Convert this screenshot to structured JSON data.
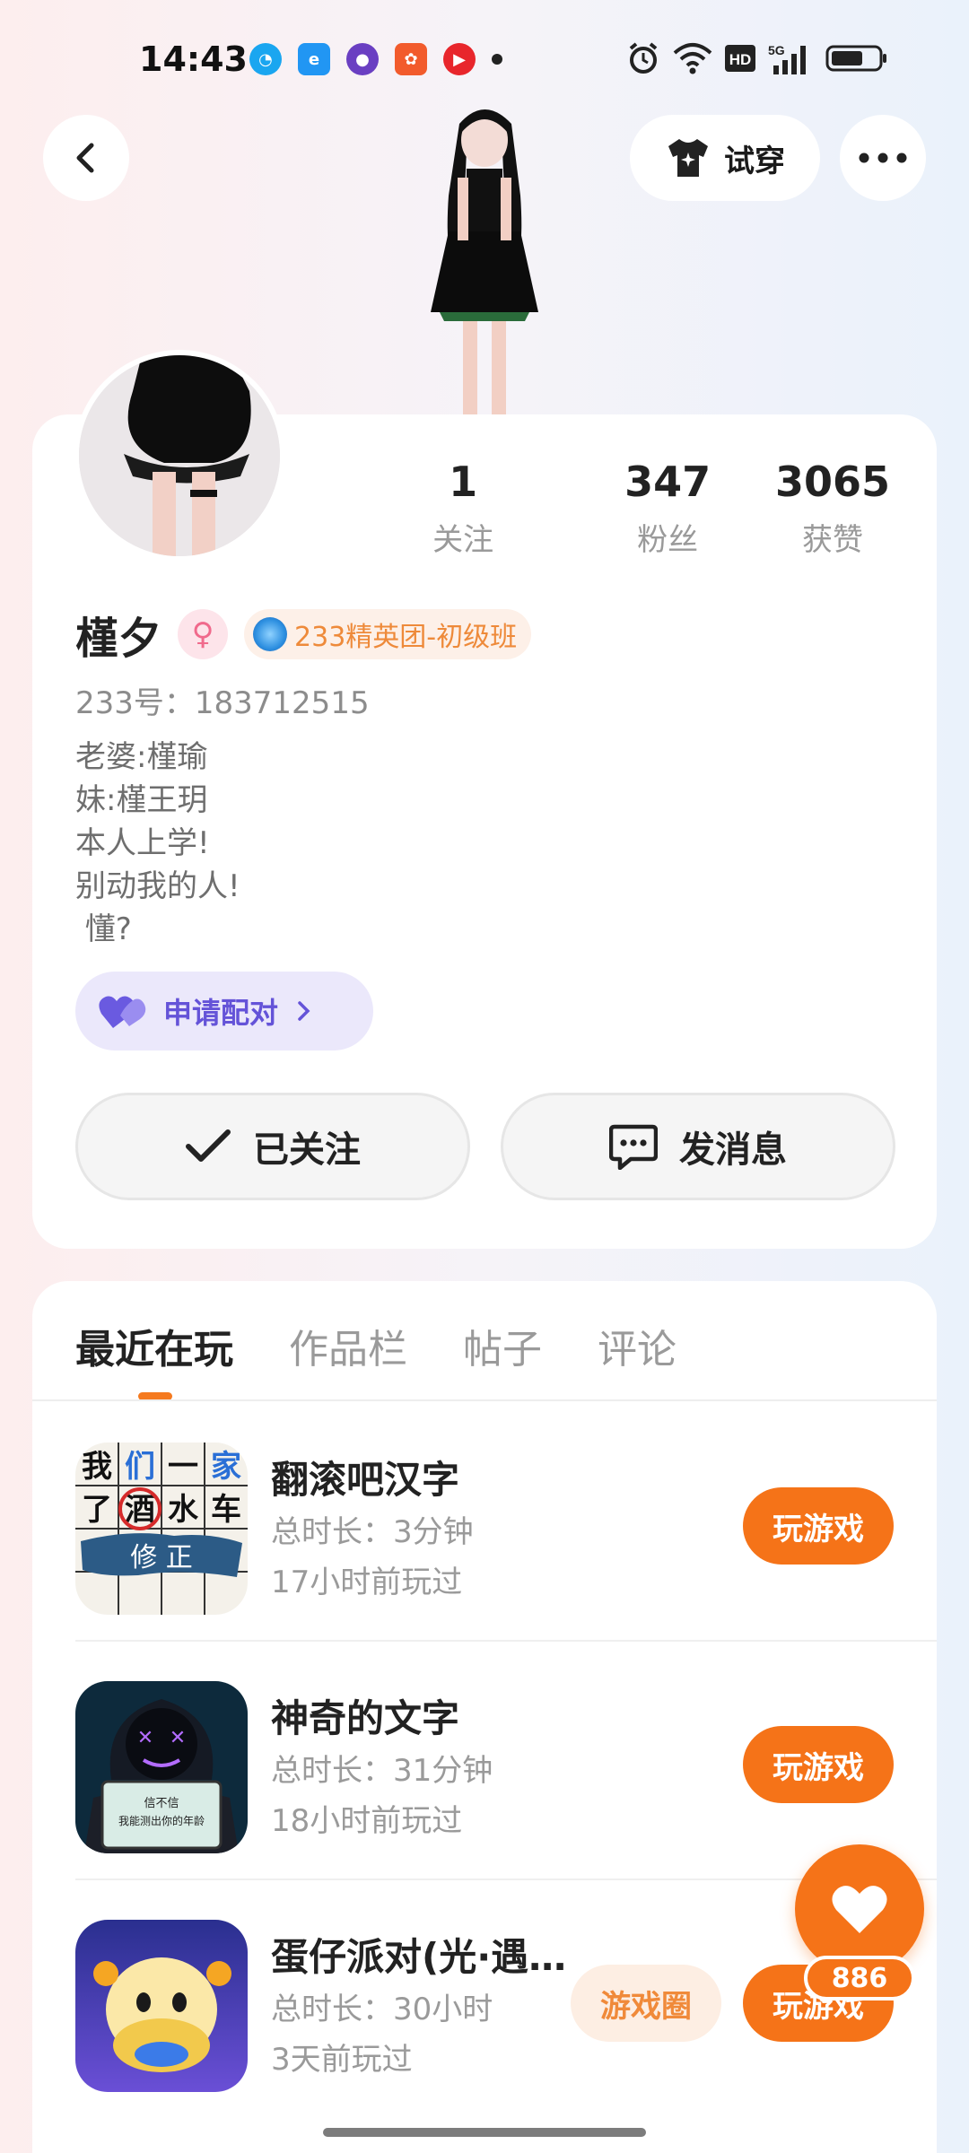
{
  "status_bar": {
    "time": "14:43",
    "notification_icons": [
      "qq-browser-icon",
      "edge-browser-icon",
      "purple-app-icon",
      "kuaishou-icon",
      "video-app-icon",
      "more-dot-icon"
    ],
    "system_icons": [
      "alarm-icon",
      "wifi-icon",
      "hd-icon",
      "5g-signal-icon",
      "battery-icon"
    ],
    "hd_label": "HD",
    "signal_label": "5G"
  },
  "header": {
    "tryon_label": "试穿"
  },
  "profile": {
    "stats": [
      {
        "value": "1",
        "label": "关注"
      },
      {
        "value": "347",
        "label": "粉丝"
      },
      {
        "value": "3065",
        "label": "获赞"
      }
    ],
    "name": "槿夕",
    "gender_symbol": "♀",
    "title_badge": "233精英团-初级班",
    "uid": "233号：183712515",
    "bio": [
      "老婆:槿瑜",
      "妹:槿王玥",
      "本人上学!",
      "别动我的人!",
      " 懂?"
    ],
    "pair_label": "申请配对",
    "follow_label": "已关注",
    "message_label": "发消息"
  },
  "tabs": [
    "最近在玩",
    "作品栏",
    "帖子",
    "评论"
  ],
  "games": [
    {
      "name": "翻滚吧汉字",
      "duration": "总时长：3分钟",
      "last_played": "17小时前玩过",
      "play_label": "玩游戏",
      "icon_text": [
        "我",
        "们",
        "一",
        "家",
        "了",
        "酒",
        "水",
        "车"
      ],
      "icon_banner": "修 正"
    },
    {
      "name": "神奇的文字",
      "duration": "总时长：31分钟",
      "last_played": "18小时前玩过",
      "play_label": "玩游戏",
      "icon_text": [
        "信不信",
        "我能测出你的年龄"
      ]
    },
    {
      "name": "蛋仔派对(光·遇…",
      "duration": "总时长：30小时",
      "last_played": "3天前玩过",
      "play_label": "玩游戏",
      "circle_label": "游戏圈"
    }
  ],
  "fab": {
    "count": "886"
  },
  "colors": {
    "accent": "#f57318",
    "pair": "#6453d8"
  }
}
